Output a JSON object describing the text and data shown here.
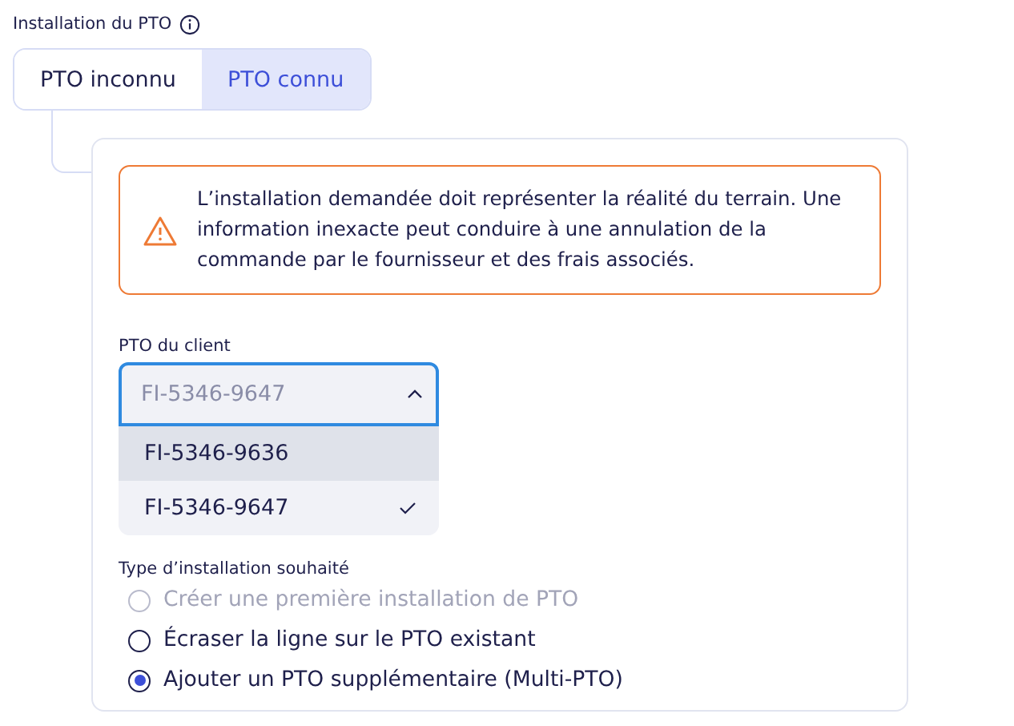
{
  "section_label": "Installation du PTO",
  "tabs": [
    {
      "label": "PTO inconnu",
      "selected": false
    },
    {
      "label": "PTO connu",
      "selected": true
    }
  ],
  "alert": {
    "message": "L’installation demandée doit représenter la réalité du terrain. Une information inexacte peut conduire à une annulation de la commande par le fournisseur et des frais associés."
  },
  "client_pto": {
    "label": "PTO du client",
    "placeholder": "FI-5346-9647",
    "expanded": true,
    "options": [
      {
        "label": "FI-5346-9636",
        "selected": false,
        "highlighted": true
      },
      {
        "label": "FI-5346-9647",
        "selected": true,
        "highlighted": false
      }
    ]
  },
  "installation_type": {
    "label": "Type d’installation souhaité",
    "options": [
      {
        "label": "Créer une première installation de PTO",
        "selected": false,
        "disabled": true
      },
      {
        "label": "Écraser la ligne sur le PTO existant",
        "selected": false,
        "disabled": false
      },
      {
        "label": "Ajouter un PTO supplémentaire (Multi-PTO)",
        "selected": true,
        "disabled": false
      }
    ]
  }
}
